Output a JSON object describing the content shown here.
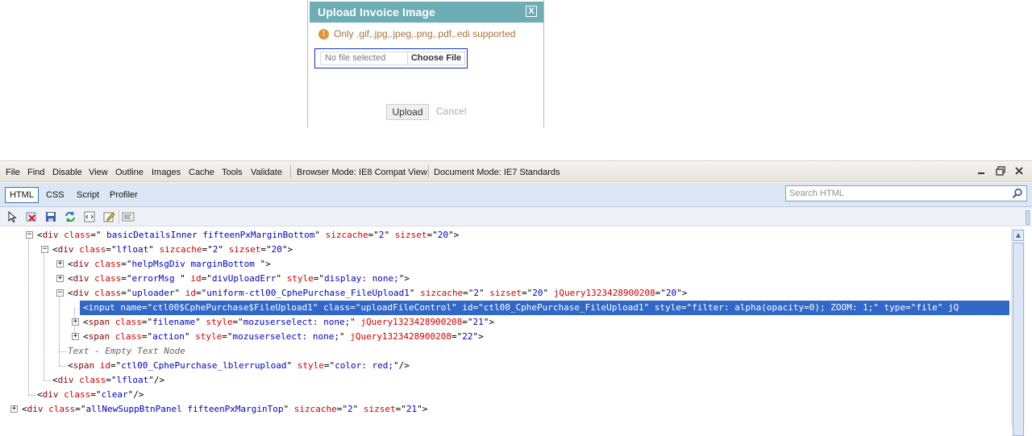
{
  "dialog": {
    "title": "Upload Invoice Image",
    "close_glyph": "X",
    "warning_text": "Only .gif,.jpg,.jpeg,.png,.pdf,.edi supported",
    "filename_placeholder": "No file selected",
    "choose_label": "Choose File",
    "upload_label": "Upload",
    "cancel_label": "Cancel",
    "colors": {
      "titlebar": "#6dadb6",
      "warning": "#a8763a",
      "cancel_link": "#93b5c9"
    }
  },
  "devtools": {
    "menu": [
      "File",
      "Find",
      "Disable",
      "View",
      "Outline",
      "Images",
      "Cache",
      "Tools",
      "Validate"
    ],
    "browser_mode": "Browser Mode: IE8 Compat View",
    "document_mode": "Document Mode: IE7 Standards",
    "tabs": [
      "HTML",
      "CSS",
      "Script",
      "Profiler"
    ],
    "active_tab": "HTML",
    "search_placeholder": "Search HTML",
    "toolbar_icons": [
      "select-element-icon",
      "clear-browser-cache-icon",
      "save-icon",
      "refresh-icon",
      "view-source-icon",
      "edit-icon",
      "word-wrap-icon"
    ],
    "tree": [
      {
        "indent": 0,
        "expander": "minus",
        "parts": [
          [
            "t-punc",
            "<"
          ],
          [
            "t-tag",
            "div"
          ],
          [
            "t-attr",
            " class"
          ],
          [
            "t-punc",
            "=\""
          ],
          [
            "t-val",
            " basicDetailsInner fifteenPxMarginBottom"
          ],
          [
            "t-punc",
            "\""
          ],
          [
            "t-attr",
            " sizcache"
          ],
          [
            "t-punc",
            "=\""
          ],
          [
            "t-val",
            "2"
          ],
          [
            "t-punc",
            "\""
          ],
          [
            "t-attr",
            " sizset"
          ],
          [
            "t-punc",
            "=\""
          ],
          [
            "t-val",
            "20"
          ],
          [
            "t-punc",
            "\">"
          ]
        ]
      },
      {
        "indent": 1,
        "expander": "minus",
        "parts": [
          [
            "t-punc",
            "<"
          ],
          [
            "t-tag",
            "div"
          ],
          [
            "t-attr",
            " class"
          ],
          [
            "t-punc",
            "=\""
          ],
          [
            "t-val",
            "lfloat"
          ],
          [
            "t-punc",
            "\""
          ],
          [
            "t-attr",
            " sizcache"
          ],
          [
            "t-punc",
            "=\""
          ],
          [
            "t-val",
            "2"
          ],
          [
            "t-punc",
            "\""
          ],
          [
            "t-attr",
            " sizset"
          ],
          [
            "t-punc",
            "=\""
          ],
          [
            "t-val",
            "20"
          ],
          [
            "t-punc",
            "\">"
          ]
        ]
      },
      {
        "indent": 2,
        "expander": "plus",
        "parts": [
          [
            "t-punc",
            "<"
          ],
          [
            "t-tag",
            "div"
          ],
          [
            "t-attr",
            " class"
          ],
          [
            "t-punc",
            "=\""
          ],
          [
            "t-val",
            "helpMsgDiv marginBottom "
          ],
          [
            "t-punc",
            "\">"
          ]
        ]
      },
      {
        "indent": 2,
        "expander": "plus",
        "parts": [
          [
            "t-punc",
            "<"
          ],
          [
            "t-tag",
            "div"
          ],
          [
            "t-attr",
            " class"
          ],
          [
            "t-punc",
            "=\""
          ],
          [
            "t-val",
            "errorMsg "
          ],
          [
            "t-punc",
            "\""
          ],
          [
            "t-attr",
            " id"
          ],
          [
            "t-punc",
            "=\""
          ],
          [
            "t-val",
            "divUploadErr"
          ],
          [
            "t-punc",
            "\""
          ],
          [
            "t-attr",
            " style"
          ],
          [
            "t-punc",
            "=\""
          ],
          [
            "t-val",
            "display: none;"
          ],
          [
            "t-punc",
            "\">"
          ]
        ]
      },
      {
        "indent": 2,
        "expander": "minus",
        "parts": [
          [
            "t-punc",
            "<"
          ],
          [
            "t-tag",
            "div"
          ],
          [
            "t-attr",
            " class"
          ],
          [
            "t-punc",
            "=\""
          ],
          [
            "t-val",
            "uploader"
          ],
          [
            "t-punc",
            "\""
          ],
          [
            "t-attr",
            " id"
          ],
          [
            "t-punc",
            "=\""
          ],
          [
            "t-val",
            "uniform-ctl00_CphePurchase_FileUpload1"
          ],
          [
            "t-punc",
            "\""
          ],
          [
            "t-attr",
            " sizcache"
          ],
          [
            "t-punc",
            "=\""
          ],
          [
            "t-val",
            "2"
          ],
          [
            "t-punc",
            "\""
          ],
          [
            "t-attr",
            " sizset"
          ],
          [
            "t-punc",
            "=\""
          ],
          [
            "t-val",
            "20"
          ],
          [
            "t-punc",
            "\""
          ],
          [
            "t-attr",
            " jQuery1323428900208"
          ],
          [
            "t-punc",
            "=\""
          ],
          [
            "t-val",
            "20"
          ],
          [
            "t-punc",
            "\">"
          ]
        ]
      },
      {
        "indent": 3,
        "expander": "none",
        "selected": true,
        "parts": [
          [
            "t-punc",
            "<"
          ],
          [
            "t-tag",
            "input"
          ],
          [
            "t-attr",
            " name"
          ],
          [
            "t-punc",
            "=\""
          ],
          [
            "t-val",
            "ctl00$CphePurchase$FileUpload1"
          ],
          [
            "t-punc",
            "\""
          ],
          [
            "t-attr",
            " class"
          ],
          [
            "t-punc",
            "=\""
          ],
          [
            "t-val",
            "uploadFileControl"
          ],
          [
            "t-punc",
            "\""
          ],
          [
            "t-attr",
            " id"
          ],
          [
            "t-punc",
            "=\""
          ],
          [
            "t-val",
            "ctl00_CphePurchase_FileUpload1"
          ],
          [
            "t-punc",
            "\""
          ],
          [
            "t-attr",
            " style"
          ],
          [
            "t-punc",
            "=\""
          ],
          [
            "t-val",
            "filter: alpha(opacity=0); ZOOM: 1;"
          ],
          [
            "t-punc",
            "\""
          ],
          [
            "t-attr",
            " type"
          ],
          [
            "t-punc",
            "=\""
          ],
          [
            "t-val",
            "file"
          ],
          [
            "t-punc",
            "\""
          ],
          [
            "t-attr",
            " jQ"
          ]
        ]
      },
      {
        "indent": 3,
        "expander": "plus",
        "parts": [
          [
            "t-punc",
            "<"
          ],
          [
            "t-tag",
            "span"
          ],
          [
            "t-attr",
            " class"
          ],
          [
            "t-punc",
            "=\""
          ],
          [
            "t-val",
            "filename"
          ],
          [
            "t-punc",
            "\""
          ],
          [
            "t-attr",
            " style"
          ],
          [
            "t-punc",
            "=\""
          ],
          [
            "t-val",
            "mozuserselect: none;"
          ],
          [
            "t-punc",
            "\""
          ],
          [
            "t-attr",
            " jQuery1323428900208"
          ],
          [
            "t-punc",
            "=\""
          ],
          [
            "t-val",
            "21"
          ],
          [
            "t-punc",
            "\">"
          ]
        ]
      },
      {
        "indent": 3,
        "expander": "plus",
        "parts": [
          [
            "t-punc",
            "<"
          ],
          [
            "t-tag",
            "span"
          ],
          [
            "t-attr",
            " class"
          ],
          [
            "t-punc",
            "=\""
          ],
          [
            "t-val",
            "action"
          ],
          [
            "t-punc",
            "\""
          ],
          [
            "t-attr",
            " style"
          ],
          [
            "t-punc",
            "=\""
          ],
          [
            "t-val",
            "mozuserselect: none;"
          ],
          [
            "t-punc",
            "\""
          ],
          [
            "t-attr",
            " jQuery1323428900208"
          ],
          [
            "t-punc",
            "=\""
          ],
          [
            "t-val",
            "22"
          ],
          [
            "t-punc",
            "\">"
          ]
        ]
      },
      {
        "indent": 2,
        "expander": "none",
        "parts": [
          [
            "t-note",
            "Text - Empty Text Node"
          ]
        ]
      },
      {
        "indent": 2,
        "expander": "none",
        "parts": [
          [
            "t-punc",
            "<"
          ],
          [
            "t-tag",
            "span"
          ],
          [
            "t-attr",
            " id"
          ],
          [
            "t-punc",
            "=\""
          ],
          [
            "t-val",
            "ctl00_CphePurchase_lblerrupload"
          ],
          [
            "t-punc",
            "\""
          ],
          [
            "t-attr",
            " style"
          ],
          [
            "t-punc",
            "=\""
          ],
          [
            "t-val",
            "color: red;"
          ],
          [
            "t-punc",
            "\"/>"
          ]
        ]
      },
      {
        "indent": 1,
        "expander": "none",
        "parts": [
          [
            "t-punc",
            "<"
          ],
          [
            "t-tag",
            "div"
          ],
          [
            "t-attr",
            " class"
          ],
          [
            "t-punc",
            "=\""
          ],
          [
            "t-val",
            "lfloat"
          ],
          [
            "t-punc",
            "\"/>"
          ]
        ]
      },
      {
        "indent": 0,
        "expander": "none",
        "parts": [
          [
            "t-punc",
            "<"
          ],
          [
            "t-tag",
            "div"
          ],
          [
            "t-attr",
            " class"
          ],
          [
            "t-punc",
            "=\""
          ],
          [
            "t-val",
            "clear"
          ],
          [
            "t-punc",
            "\"/>"
          ]
        ]
      },
      {
        "indent": -1,
        "expander": "plus",
        "parts": [
          [
            "t-punc",
            "<"
          ],
          [
            "t-tag",
            "div"
          ],
          [
            "t-attr",
            " class"
          ],
          [
            "t-punc",
            "=\""
          ],
          [
            "t-val",
            "allNewSuppBtnPanel fifteenPxMarginTop"
          ],
          [
            "t-punc",
            "\""
          ],
          [
            "t-attr",
            " sizcache"
          ],
          [
            "t-punc",
            "=\""
          ],
          [
            "t-val",
            "2"
          ],
          [
            "t-punc",
            "\""
          ],
          [
            "t-attr",
            " sizset"
          ],
          [
            "t-punc",
            "=\""
          ],
          [
            "t-val",
            "21"
          ],
          [
            "t-punc",
            "\">"
          ]
        ]
      }
    ]
  }
}
